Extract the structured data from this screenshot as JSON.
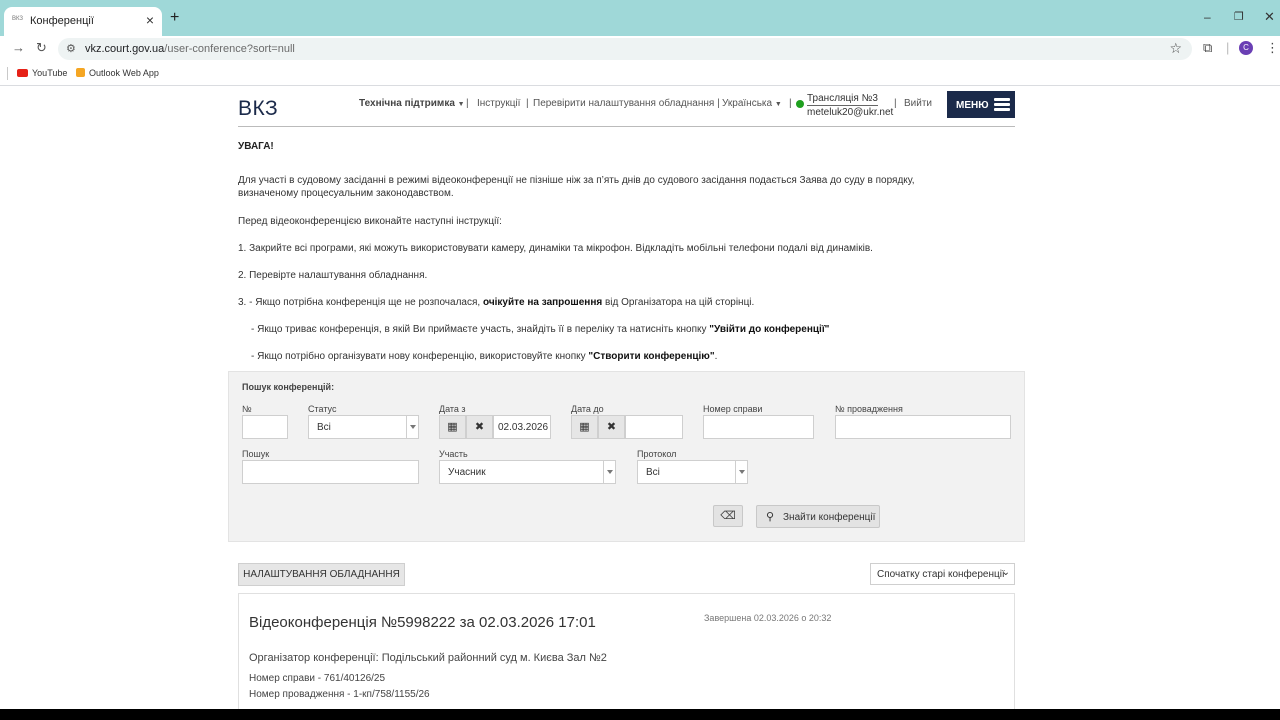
{
  "browser": {
    "tab_title": "Конференції",
    "favicon_text": "ВКЗ",
    "url_host": "vkz.court.gov.ua",
    "url_path": "/user-conference?sort=null",
    "profile_initial": "C",
    "bookmarks": [
      {
        "label": "YouTube",
        "icon": "youtube-icon"
      },
      {
        "label": "Outlook Web App",
        "icon": "outlook-icon"
      }
    ]
  },
  "header": {
    "brand": "ВКЗ",
    "support": "Технічна підтримка",
    "instructions": "Інструкції",
    "check_settings": "Перевірити налаштування обладнання |",
    "language": "Українська",
    "user_name": "Трансляція №3",
    "user_email": "meteluk20@ukr.net",
    "logout": "Вийти",
    "menu": "МЕНЮ"
  },
  "notice": {
    "title": "УВАГА!",
    "p1": "Для участі в судовому засіданні в режимі відеоконференції не пізніше ніж за п’ять днів до судового засідання подається Заява до суду в порядку, визначеному процесуальним законодавством.",
    "intro": "Перед відеоконференцією виконайте наступні інструкції:",
    "step1": "1. Закрийте всі програми, які можуть використовувати камеру, динаміки та мікрофон. Відкладіть мобільні телефони подалі від динаміків.",
    "step2": "2. Перевірте налаштування обладнання.",
    "step3_pre": "3.  - Якщо потрібна конференція ще не розпочалася, ",
    "step3_bold": "очікуйте на запрошення",
    "step3_post": " від Організатора на цій сторінці.",
    "step3b_pre": "- Якщо триває конференція, в якій Ви приймаєте участь, знайдіть її в переліку та натисніть кнопку ",
    "step3b_bold": "\"Увійти до конференції\"",
    "step3c_pre": "- Якщо потрібно організувати нову конференцію, використовуйте кнопку ",
    "step3c_bold": "\"Створити конференцію\"",
    "step3c_post": "."
  },
  "search": {
    "title": "Пошук конференцій:",
    "number_label": "№",
    "number_value": "",
    "status_label": "Статус",
    "status_value": "Всі",
    "date_from_label": "Дата з",
    "date_from_value": "02.03.2026",
    "date_to_label": "Дата до",
    "date_to_value": "",
    "case_number_label": "Номер справи",
    "proceeding_label": "№ провадження",
    "query_label": "Пошук",
    "participation_label": "Участь",
    "participation_value": "Учасник",
    "protocol_label": "Протокол",
    "protocol_value": "Всі",
    "find_button": "Знайти конференції"
  },
  "settings_button": "НАЛАШТУВАННЯ ОБЛАДНАННЯ",
  "sort_value": "Спочатку старі конференції",
  "conference": {
    "title": "Відеоконференція №5998222 за 02.03.2026 17:01",
    "status": "Завершена 02.03.2026 о 20:32",
    "organizer": "Організатор конференції: Подільський районний суд м. Києва Зал №2",
    "case_number": "Номер справи - 761/40126/25",
    "proceeding_number": "Номер провадження - 1-кп/758/1155/26"
  }
}
